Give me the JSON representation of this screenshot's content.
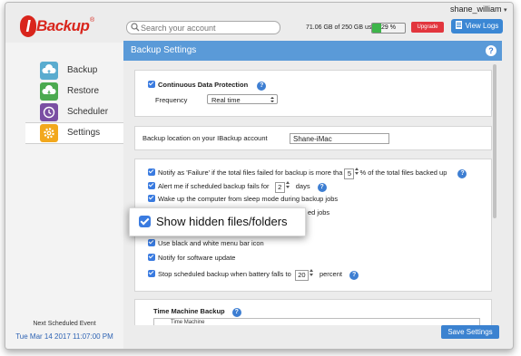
{
  "header": {
    "logo_text": "IBackup",
    "search_placeholder": "Search your account",
    "username": "shane_william",
    "usage_text": "71.06 GB of 250 GB used",
    "usage_percent": 29,
    "usage_percent_label": "29 %",
    "upgrade_label": "Upgrade",
    "view_logs_label": "View Logs"
  },
  "sidebar": {
    "items": [
      {
        "label": "Backup",
        "icon": "backup-icon",
        "color": "#5aaccf"
      },
      {
        "label": "Restore",
        "icon": "restore-icon",
        "color": "#4caa50"
      },
      {
        "label": "Scheduler",
        "icon": "scheduler-icon",
        "color": "#7a4ea3"
      },
      {
        "label": "Settings",
        "icon": "gear-icon",
        "color": "#f2a81d",
        "active": true
      }
    ],
    "next_event_title": "Next Scheduled Event",
    "next_event_date": "Tue Mar 14 2017 11:07:00 PM"
  },
  "panel": {
    "title": "Backup Settings",
    "cdp": {
      "label": "Continuous Data Protection",
      "frequency_label": "Frequency",
      "frequency_value": "Real time"
    },
    "location": {
      "label": "Backup location on your IBackup account",
      "value": "Shane-iMac"
    },
    "options": {
      "notify_failure_prefix": "Notify as 'Failure' if the total files failed for backup is more tha",
      "notify_failure_value": "5",
      "notify_failure_suffix": "% of the total files backed up",
      "alert_prefix": "Alert me if scheduled backup fails for",
      "alert_value": "2",
      "alert_suffix": "days",
      "wake_label": "Wake up the computer from sleep mode during backup jobs",
      "partial_label": "ed jobs",
      "menubar_label": "Use black and white menu bar icon",
      "notify_update_label": "Notify for software update",
      "battery_prefix": "Stop scheduled backup when battery falls to",
      "battery_value": "20",
      "battery_suffix": "percent"
    },
    "time_machine": {
      "label": "Time Machine Backup",
      "cut_text": "Time Machine"
    },
    "save_label": "Save Settings",
    "help_label": "?"
  },
  "zoom": {
    "label": "Show hidden files/folders"
  },
  "colors": {
    "accent": "#3b82d0",
    "header_bar": "#5a9ad8",
    "brand": "#d9251c",
    "upgrade": "#e2363e",
    "usage_fill": "#3eb54a"
  }
}
